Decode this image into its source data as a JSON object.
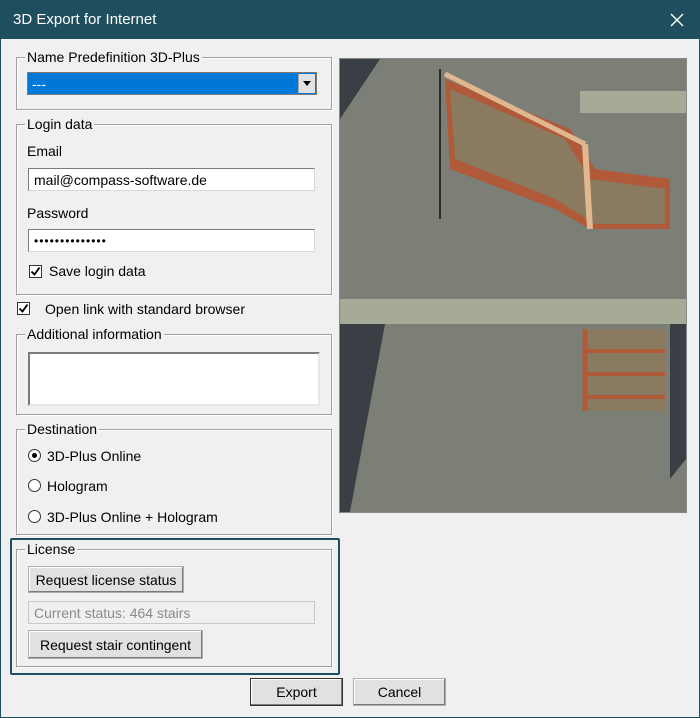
{
  "window": {
    "title": "3D Export for Internet",
    "close_icon": "close-icon"
  },
  "name_group": {
    "legend": "Name Predefinition 3D-Plus",
    "selected": "---"
  },
  "login_group": {
    "legend": "Login data",
    "email_label": "Email",
    "email_value": "mail@compass-software.de",
    "password_label": "Password",
    "password_value": "••••••••••••••",
    "save_label": "Save login data",
    "save_checked": true
  },
  "open_link": {
    "label": "Open link with standard browser",
    "checked": true
  },
  "additional_group": {
    "legend": "Additional information",
    "value": ""
  },
  "destination_group": {
    "legend": "Destination",
    "options": [
      "3D-Plus Online",
      "Hologram",
      "3D-Plus Online + Hologram"
    ],
    "selected_index": 0
  },
  "license_group": {
    "legend": "License",
    "request_status_label": "Request license status",
    "status_value": "Current status: 464 stairs",
    "request_contingent_label": "Request stair contingent"
  },
  "footer": {
    "export_label": "Export",
    "cancel_label": "Cancel"
  },
  "colors": {
    "titlebar": "#1f4e5f",
    "highlight_border": "#1f4e5f",
    "selection": "#0078d7"
  }
}
